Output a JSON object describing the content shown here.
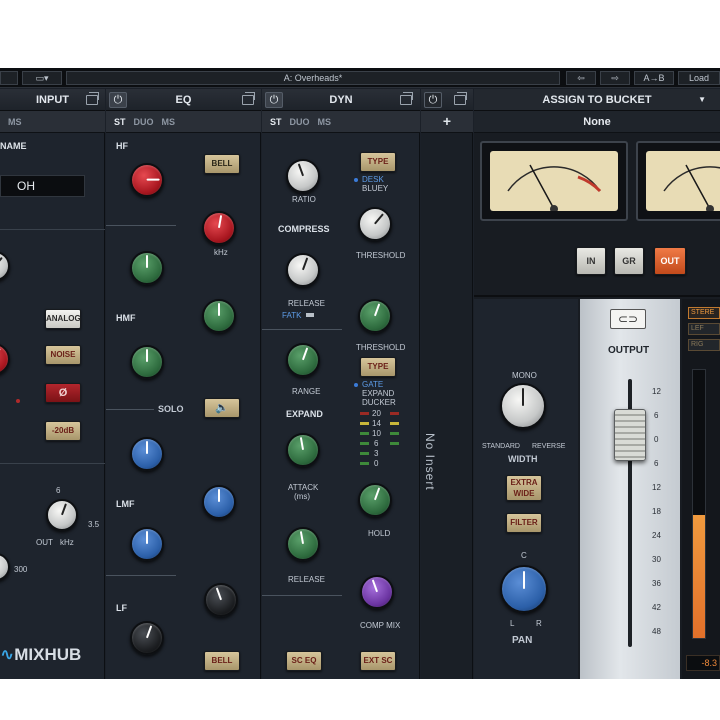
{
  "topbar": {
    "preset": "A: Overheads*",
    "ab": "A→B",
    "load": "Load"
  },
  "input": {
    "header": "INPUT",
    "modes": [
      "MS"
    ],
    "name_label": "NAME",
    "name_value": "OH",
    "buttons": {
      "analog": "ANALOG",
      "noise": "NOISE",
      "phase": "Ø",
      "pad": "-20dB"
    },
    "knob_labels": {
      "out": "OUT",
      "khz": "kHz",
      "scale_a": "6",
      "scale_b": "3.5",
      "scale_c": "300"
    },
    "logo": "MIXHUB"
  },
  "eq": {
    "header": "EQ",
    "modes": [
      "ST",
      "DUO",
      "MS"
    ],
    "bands": {
      "hf": "HF",
      "hmf": "HMF",
      "lmf": "LMF",
      "lf": "LF"
    },
    "buttons": {
      "bell_top": "BELL",
      "bell_bottom": "BELL"
    },
    "solo": "SOLO",
    "units": {
      "khz": "kHz"
    }
  },
  "dyn": {
    "header": "DYN",
    "modes": [
      "ST",
      "DUO",
      "MS"
    ],
    "labels": {
      "ratio": "RATIO",
      "compress": "COMPRESS",
      "threshold": "THRESHOLD",
      "release": "RELEASE",
      "fatk": "FATK",
      "range": "RANGE",
      "expand": "EXPAND",
      "attack": "ATTACK",
      "attack_unit": "(ms)",
      "hold": "HOLD",
      "comp_mix": "COMP MIX",
      "desk": "DESK",
      "bluey": "BLUEY",
      "gate": "GATE",
      "expand_ducker": "EXPAND",
      "ducker": "DUCKER"
    },
    "buttons": {
      "type_top": "TYPE",
      "type_mid": "TYPE",
      "sc_eq": "SC EQ",
      "ext_sc": "EXT SC"
    },
    "gr_meter": [
      "20",
      "14",
      "10",
      "6",
      "3",
      "0"
    ]
  },
  "insert": {
    "add": "+",
    "label": "No Insert"
  },
  "output": {
    "assign_label": "ASSIGN TO BUCKET",
    "bucket_value": "None",
    "meter_buttons": [
      "IN",
      "GR",
      "OUT"
    ],
    "section_label": "OUTPUT",
    "width": {
      "mono": "MONO",
      "standard": "STANDARD",
      "reverse": "REVERSE",
      "label": "WIDTH"
    },
    "extra_wide": "EXTRA WIDE",
    "filter": "FILTER",
    "pan": {
      "c": "C",
      "l": "L",
      "r": "R",
      "label": "PAN"
    },
    "fader_scale": [
      "12",
      "6",
      "0",
      "6",
      "12",
      "18",
      "24",
      "30",
      "36",
      "42",
      "48"
    ],
    "meter_tabs": [
      "STERE",
      "LEF",
      "RIG"
    ],
    "readout": "-8.3"
  },
  "colors": {
    "background": "#1b2028",
    "accent_orange": "#f07a46",
    "knob_red": "#c62a33",
    "knob_green": "#2d6a3d",
    "knob_blue": "#2b5fa8"
  }
}
